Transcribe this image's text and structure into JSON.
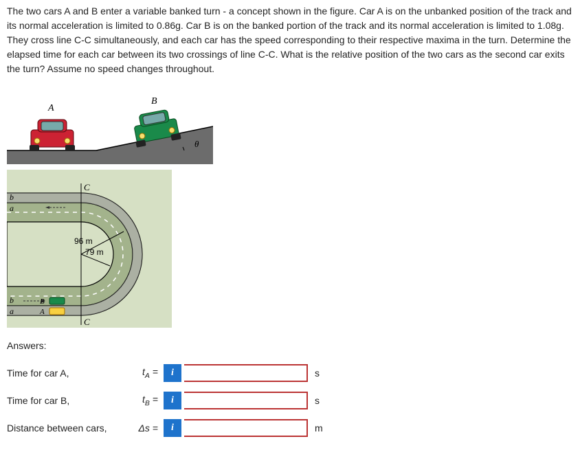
{
  "problem": {
    "text": "The two cars A and B enter a variable banked turn - a concept shown in the figure. Car A is on the unbanked position of the track and its normal acceleration is limited to 0.86g. Car B is on the banked portion of the track and its normal acceleration is limited to 1.08g. They cross line C-C simultaneously, and each car has the speed corresponding to their respective maxima in the turn. Determine the elapsed time for each car between its two crossings of line C-C. What is the relative position of the two cars as the second car exits the turn? Assume no speed changes throughout."
  },
  "figure": {
    "carA_label": "A",
    "carB_label": "B",
    "bankAngle_label": "θ",
    "track": {
      "lane_b_top": "b",
      "lane_a_top": "a",
      "lane_b_bottom": "b",
      "lane_a_bottom": "a",
      "carA_tag": "A",
      "carB_tag": "B",
      "line_label_top": "C",
      "line_label_bottom": "C",
      "radius_outer": "96 m",
      "radius_inner": "79 m"
    }
  },
  "answers": {
    "heading": "Answers:",
    "rowA": {
      "label": "Time for car A,",
      "symbol_main": "t",
      "symbol_sub": "A",
      "eq": " =",
      "info": "i",
      "value": "",
      "unit": "s"
    },
    "rowB": {
      "label": "Time for car B,",
      "symbol_main": "t",
      "symbol_sub": "B",
      "eq": " =",
      "info": "i",
      "value": "",
      "unit": "s"
    },
    "rowD": {
      "label": "Distance between cars,",
      "symbol_main": "Δs",
      "symbol_sub": "",
      "eq": " =",
      "info": "i",
      "value": "",
      "unit": "m"
    }
  }
}
